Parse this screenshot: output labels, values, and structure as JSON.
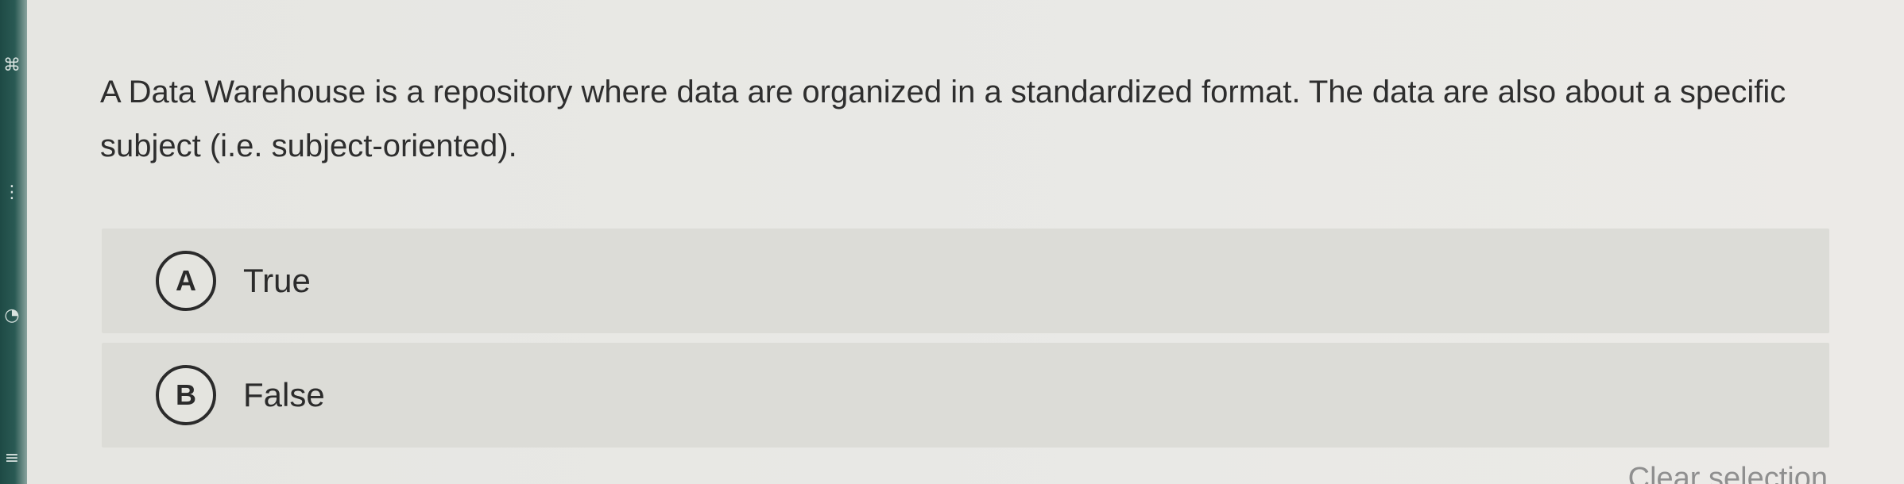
{
  "question": {
    "text": "A Data Warehouse is a repository where data are organized in a standardized format. The data are also about a specific subject (i.e. subject-oriented)."
  },
  "options": [
    {
      "letter": "A",
      "label": "True"
    },
    {
      "letter": "B",
      "label": "False"
    }
  ],
  "clear_selection_label": "Clear selection",
  "colors": {
    "background": "#e8e8e4",
    "option_background": "#dcdcd7",
    "text": "#2b2b2b",
    "muted_link": "#8f8f8f",
    "sidebar_strip": "#2a5a54"
  }
}
